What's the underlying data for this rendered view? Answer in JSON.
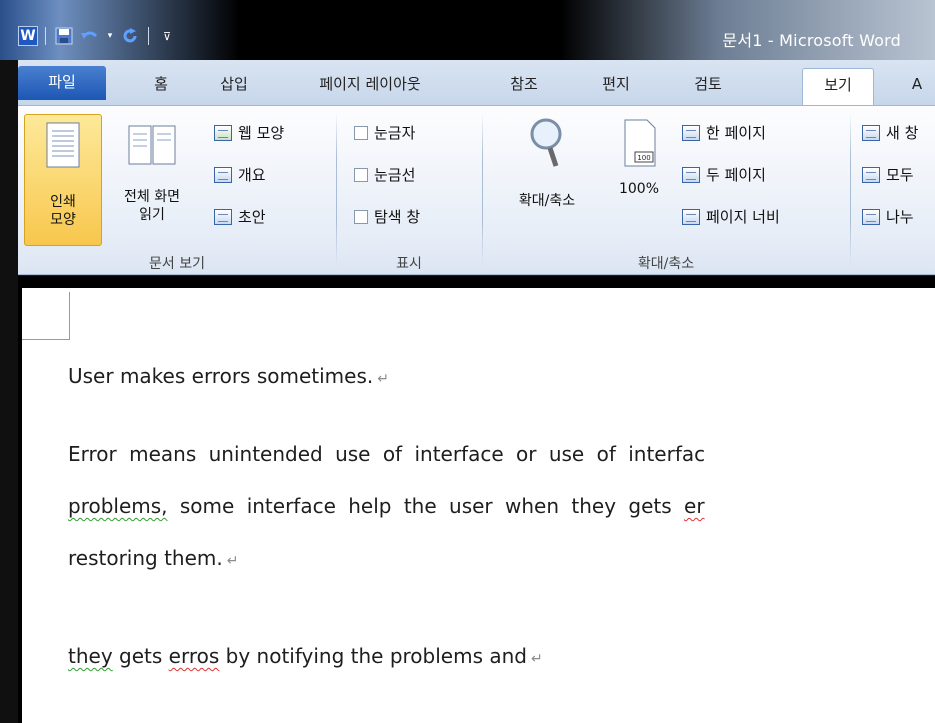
{
  "window": {
    "title": "문서1  -  Microsoft Word",
    "logo_letter": "W"
  },
  "quick_access": {
    "items": [
      "save-icon",
      "undo-icon",
      "redo-icon",
      "customize-icon"
    ]
  },
  "tabs": [
    {
      "label": "파일",
      "type": "file"
    },
    {
      "label": "홈"
    },
    {
      "label": "삽입"
    },
    {
      "label": "페이지 레이아웃"
    },
    {
      "label": "참조"
    },
    {
      "label": "편지"
    },
    {
      "label": "검토"
    },
    {
      "label": "보기",
      "active": true
    },
    {
      "label": "A"
    }
  ],
  "ribbon": {
    "doc_views": {
      "group_label": "문서 보기",
      "print_layout_label": "인쇄\n모양",
      "full_screen_label": "전체 화면\n읽기",
      "web_layout": "웹 모양",
      "outline": "개요",
      "draft": "초안"
    },
    "show": {
      "group_label": "표시",
      "ruler": "눈금자",
      "gridlines": "눈금선",
      "nav_pane": "탐색 창"
    },
    "zoom": {
      "group_label": "확대/축소",
      "zoom_label": "확대/축소",
      "hundred_label": "100%",
      "hundred_icon_text": "100",
      "one_page": "한 페이지",
      "two_pages": "두 페이지",
      "page_width": "페이지 너비"
    },
    "window_group": {
      "new_window": "새 창",
      "arrange_all": "모두",
      "split": "나누"
    }
  },
  "document": {
    "p1": "User makes errors sometimes.",
    "p2_line1": "Error means unintended use of interface or use of interfac",
    "p2_line2_w1": "problems,",
    "p2_line2_rest": " some interface help the user when they gets ",
    "p2_line2_tail": "er",
    "p2_line3": "restoring them.",
    "p3_w1": "they",
    "p3_mid": " gets ",
    "p3_w2": "erros",
    "p3_rest": " by notifying the problems and",
    "pilcrow": "↵"
  }
}
